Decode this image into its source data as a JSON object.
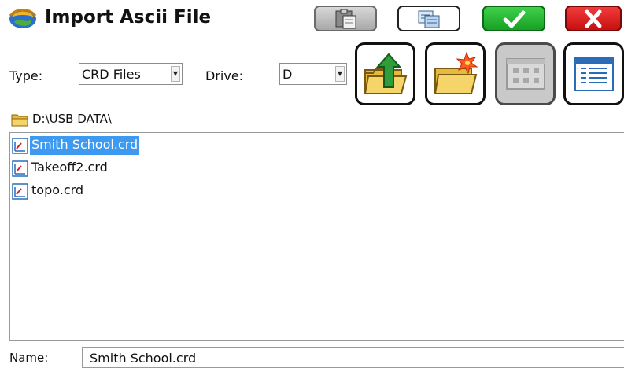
{
  "window": {
    "title": "Import Ascii File",
    "icon": "globe-icon"
  },
  "toolbar": {
    "paste_icon": "paste-icon",
    "copy_icon": "copy-icon",
    "ok_icon": "checkmark-icon",
    "close_icon": "close-icon",
    "ok_color": "#22b02e",
    "close_color": "#e02020"
  },
  "filters": {
    "type_label": "Type:",
    "type_value": "CRD Files",
    "drive_label": "Drive:",
    "drive_value": "D"
  },
  "actions": [
    {
      "icon": "folder-up-icon",
      "enabled": true
    },
    {
      "icon": "new-folder-icon",
      "enabled": true
    },
    {
      "icon": "grid-view-icon",
      "enabled": false
    },
    {
      "icon": "list-view-icon",
      "enabled": true
    }
  ],
  "path": {
    "icon": "folder-icon",
    "text": "D:\\USB DATA\\"
  },
  "files": [
    {
      "name": "Smith School.crd",
      "selected": true
    },
    {
      "name": "Takeoff2.crd",
      "selected": false
    },
    {
      "name": "topo.crd",
      "selected": false
    }
  ],
  "name_field": {
    "label": "Name:",
    "value": "Smith School.crd"
  }
}
